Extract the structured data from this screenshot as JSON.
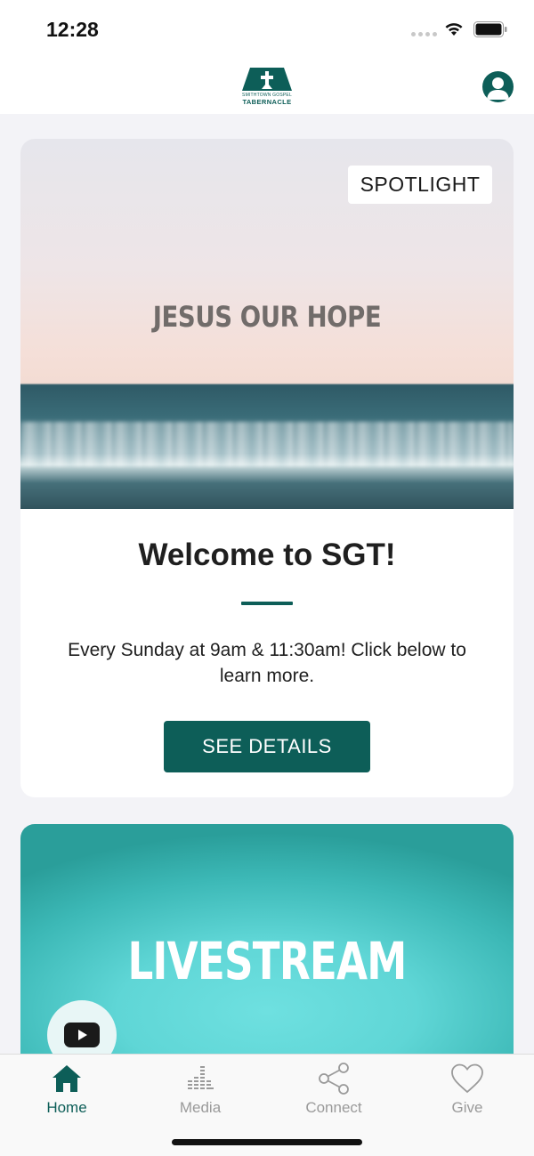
{
  "status_bar": {
    "time": "12:28"
  },
  "header": {
    "logo_line1": "SMITHTOWN GOSPEL",
    "logo_line2": "TABERNACLE",
    "profile_icon": "person-icon"
  },
  "spotlight": {
    "badge": "SPOTLIGHT",
    "image_headline": "JESUS OUR HOPE",
    "title": "Welcome to SGT!",
    "description": "Every Sunday at 9am & 11:30am! Click below to learn more.",
    "button_label": "SEE DETAILS"
  },
  "livestream": {
    "title": "LIVESTREAM",
    "play_icon": "youtube-icon"
  },
  "tabs": [
    {
      "label": "Home",
      "icon": "home-icon",
      "active": true
    },
    {
      "label": "Media",
      "icon": "equalizer-icon",
      "active": false
    },
    {
      "label": "Connect",
      "icon": "share-icon",
      "active": false
    },
    {
      "label": "Give",
      "icon": "heart-icon",
      "active": false
    }
  ],
  "colors": {
    "brand": "#0d5e58",
    "inactive": "#9a9a9a"
  }
}
